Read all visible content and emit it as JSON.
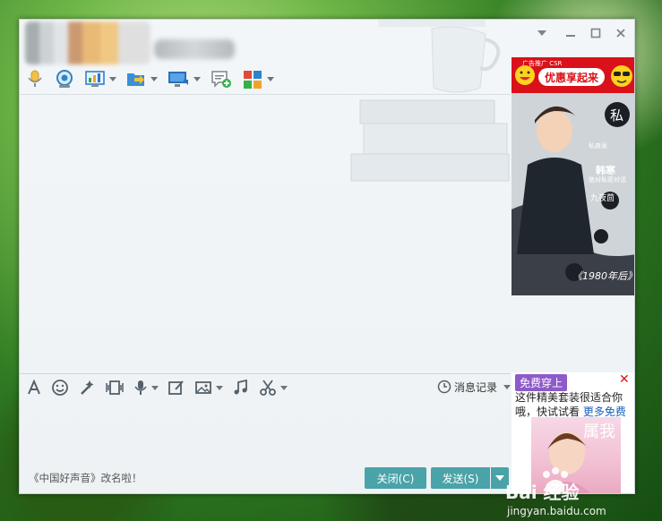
{
  "window": {
    "controls": [
      "collapse",
      "minimize",
      "maximize",
      "close"
    ]
  },
  "toolbar_top": [
    {
      "name": "voice-call",
      "icon": "microphone-icon"
    },
    {
      "name": "video-call",
      "icon": "webcam-icon"
    },
    {
      "name": "remote-assist",
      "icon": "chart-screen-icon",
      "dropdown": true
    },
    {
      "name": "send-file",
      "icon": "folder-send-icon",
      "dropdown": true
    },
    {
      "name": "screen-share",
      "icon": "monitor-icon",
      "dropdown": true
    },
    {
      "name": "create-discussion",
      "icon": "chat-add-icon"
    },
    {
      "name": "apps",
      "icon": "apps-grid-icon",
      "dropdown": true
    }
  ],
  "toolbar_bottom": {
    "message_record_label": "消息记录",
    "tools": [
      "font-icon",
      "emoji-icon",
      "wand-icon",
      "shake-icon",
      "voice-message-icon",
      "edit-image-icon",
      "picture-icon",
      "music-icon",
      "scissors-icon"
    ]
  },
  "status_tip": "《中国好声音》改名啦！",
  "buttons": {
    "close_label": "关闭(C)",
    "send_label": "发送(S)"
  },
  "ads": {
    "top_mini": "广告推广 CSR",
    "top_banner": "优惠享起来",
    "main_badge": "私",
    "main_lines": [
      "私夜泉",
      "韩寒",
      "绝对私密对话",
      "九夜茴",
      "《1980年后》"
    ],
    "bottom_badge": "免费穿上",
    "bottom_text": "这件精美套装很适合你哦，快试试看",
    "bottom_link": "更多免费",
    "bottom_photo_text": "属我"
  },
  "watermark": {
    "brand": "Bai 经验",
    "url": "jingyan.baidu.com"
  },
  "colors": {
    "accent_button": "#4aa3a8",
    "ad_red": "#d9111a",
    "badge_purple": "#8e5ac9",
    "link_blue": "#1a5fb4"
  }
}
